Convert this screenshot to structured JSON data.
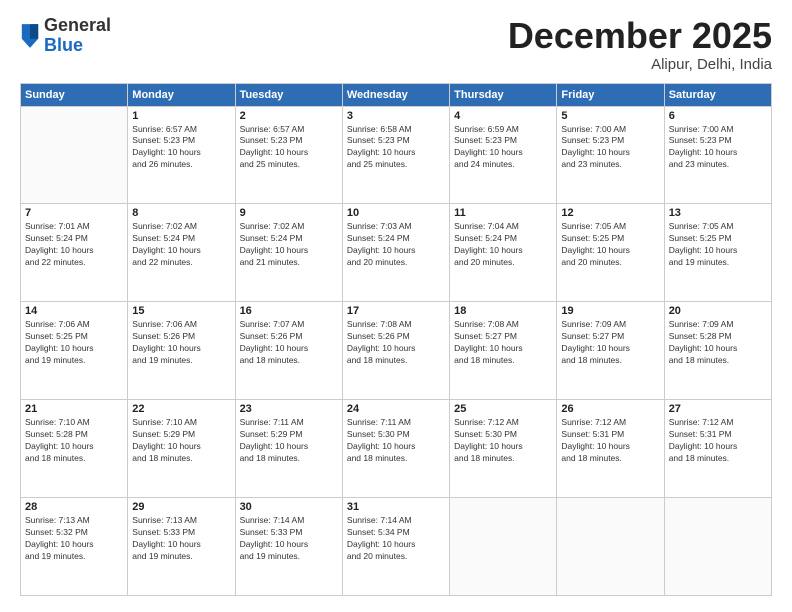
{
  "header": {
    "logo_general": "General",
    "logo_blue": "Blue",
    "month": "December 2025",
    "location": "Alipur, Delhi, India"
  },
  "calendar": {
    "days_of_week": [
      "Sunday",
      "Monday",
      "Tuesday",
      "Wednesday",
      "Thursday",
      "Friday",
      "Saturday"
    ],
    "weeks": [
      [
        {
          "day": "",
          "info": ""
        },
        {
          "day": "1",
          "info": "Sunrise: 6:57 AM\nSunset: 5:23 PM\nDaylight: 10 hours\nand 26 minutes."
        },
        {
          "day": "2",
          "info": "Sunrise: 6:57 AM\nSunset: 5:23 PM\nDaylight: 10 hours\nand 25 minutes."
        },
        {
          "day": "3",
          "info": "Sunrise: 6:58 AM\nSunset: 5:23 PM\nDaylight: 10 hours\nand 25 minutes."
        },
        {
          "day": "4",
          "info": "Sunrise: 6:59 AM\nSunset: 5:23 PM\nDaylight: 10 hours\nand 24 minutes."
        },
        {
          "day": "5",
          "info": "Sunrise: 7:00 AM\nSunset: 5:23 PM\nDaylight: 10 hours\nand 23 minutes."
        },
        {
          "day": "6",
          "info": "Sunrise: 7:00 AM\nSunset: 5:23 PM\nDaylight: 10 hours\nand 23 minutes."
        }
      ],
      [
        {
          "day": "7",
          "info": "Sunrise: 7:01 AM\nSunset: 5:24 PM\nDaylight: 10 hours\nand 22 minutes."
        },
        {
          "day": "8",
          "info": "Sunrise: 7:02 AM\nSunset: 5:24 PM\nDaylight: 10 hours\nand 22 minutes."
        },
        {
          "day": "9",
          "info": "Sunrise: 7:02 AM\nSunset: 5:24 PM\nDaylight: 10 hours\nand 21 minutes."
        },
        {
          "day": "10",
          "info": "Sunrise: 7:03 AM\nSunset: 5:24 PM\nDaylight: 10 hours\nand 20 minutes."
        },
        {
          "day": "11",
          "info": "Sunrise: 7:04 AM\nSunset: 5:24 PM\nDaylight: 10 hours\nand 20 minutes."
        },
        {
          "day": "12",
          "info": "Sunrise: 7:05 AM\nSunset: 5:25 PM\nDaylight: 10 hours\nand 20 minutes."
        },
        {
          "day": "13",
          "info": "Sunrise: 7:05 AM\nSunset: 5:25 PM\nDaylight: 10 hours\nand 19 minutes."
        }
      ],
      [
        {
          "day": "14",
          "info": "Sunrise: 7:06 AM\nSunset: 5:25 PM\nDaylight: 10 hours\nand 19 minutes."
        },
        {
          "day": "15",
          "info": "Sunrise: 7:06 AM\nSunset: 5:26 PM\nDaylight: 10 hours\nand 19 minutes."
        },
        {
          "day": "16",
          "info": "Sunrise: 7:07 AM\nSunset: 5:26 PM\nDaylight: 10 hours\nand 18 minutes."
        },
        {
          "day": "17",
          "info": "Sunrise: 7:08 AM\nSunset: 5:26 PM\nDaylight: 10 hours\nand 18 minutes."
        },
        {
          "day": "18",
          "info": "Sunrise: 7:08 AM\nSunset: 5:27 PM\nDaylight: 10 hours\nand 18 minutes."
        },
        {
          "day": "19",
          "info": "Sunrise: 7:09 AM\nSunset: 5:27 PM\nDaylight: 10 hours\nand 18 minutes."
        },
        {
          "day": "20",
          "info": "Sunrise: 7:09 AM\nSunset: 5:28 PM\nDaylight: 10 hours\nand 18 minutes."
        }
      ],
      [
        {
          "day": "21",
          "info": "Sunrise: 7:10 AM\nSunset: 5:28 PM\nDaylight: 10 hours\nand 18 minutes."
        },
        {
          "day": "22",
          "info": "Sunrise: 7:10 AM\nSunset: 5:29 PM\nDaylight: 10 hours\nand 18 minutes."
        },
        {
          "day": "23",
          "info": "Sunrise: 7:11 AM\nSunset: 5:29 PM\nDaylight: 10 hours\nand 18 minutes."
        },
        {
          "day": "24",
          "info": "Sunrise: 7:11 AM\nSunset: 5:30 PM\nDaylight: 10 hours\nand 18 minutes."
        },
        {
          "day": "25",
          "info": "Sunrise: 7:12 AM\nSunset: 5:30 PM\nDaylight: 10 hours\nand 18 minutes."
        },
        {
          "day": "26",
          "info": "Sunrise: 7:12 AM\nSunset: 5:31 PM\nDaylight: 10 hours\nand 18 minutes."
        },
        {
          "day": "27",
          "info": "Sunrise: 7:12 AM\nSunset: 5:31 PM\nDaylight: 10 hours\nand 18 minutes."
        }
      ],
      [
        {
          "day": "28",
          "info": "Sunrise: 7:13 AM\nSunset: 5:32 PM\nDaylight: 10 hours\nand 19 minutes."
        },
        {
          "day": "29",
          "info": "Sunrise: 7:13 AM\nSunset: 5:33 PM\nDaylight: 10 hours\nand 19 minutes."
        },
        {
          "day": "30",
          "info": "Sunrise: 7:14 AM\nSunset: 5:33 PM\nDaylight: 10 hours\nand 19 minutes."
        },
        {
          "day": "31",
          "info": "Sunrise: 7:14 AM\nSunset: 5:34 PM\nDaylight: 10 hours\nand 20 minutes."
        },
        {
          "day": "",
          "info": ""
        },
        {
          "day": "",
          "info": ""
        },
        {
          "day": "",
          "info": ""
        }
      ]
    ]
  }
}
